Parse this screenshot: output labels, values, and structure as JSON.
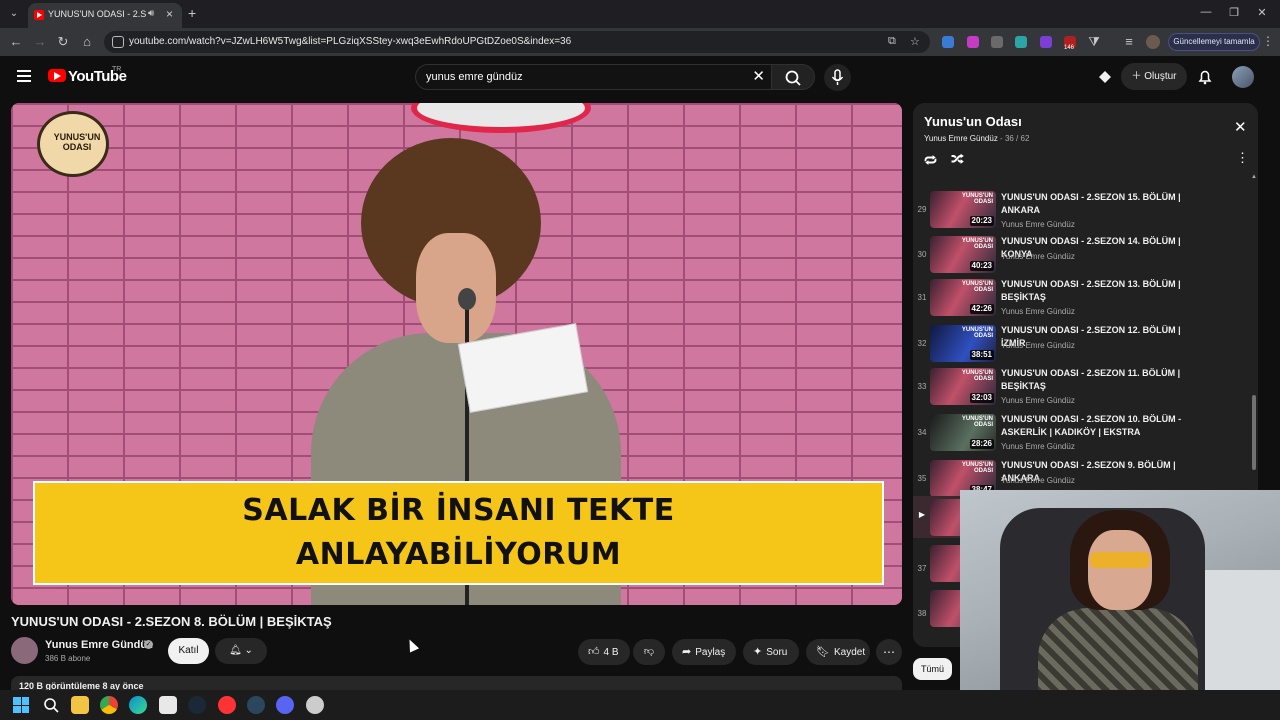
{
  "browser": {
    "tab_title": "YUNUS'UN ODASI - 2.SEZON 8. B",
    "url": "youtube.com/watch?v=JZwLH6W5Twg&list=PLGziqXSStey-xwq3eEwhRdoUPGtDZoe0S&index=36",
    "update_button": "Güncellemeyi tamamla",
    "extension_badge": "146"
  },
  "header": {
    "logo_text": "YouTube",
    "region": "TR",
    "search_value": "yunus emre gündüz",
    "create_label": "Oluştur"
  },
  "player": {
    "caption_line1": "SALAK BİR İNSANI TEKTE",
    "caption_line2": "ANLAYABİLİYORUM",
    "corner_logo": "YUNUS'UN ODASI"
  },
  "video": {
    "title": "YUNUS'UN ODASI - 2.SEZON 8. BÖLÜM | BEŞİKTAŞ",
    "channel": "Yunus Emre Gündüz",
    "subscribers": "386 B abone",
    "join_label": "Katıl",
    "likes": "4 B",
    "share_label": "Paylaş",
    "ask_label": "Soru",
    "save_label": "Kaydet",
    "description_peek": "120 B görüntüleme  8 ay önce"
  },
  "playlist": {
    "title": "Yunus'un Odası",
    "owner": "Yunus Emre Gündüz",
    "position": "36 / 62",
    "items": [
      {
        "index": "29",
        "title": "YUNUS'UN ODASI - 2.SEZON 15. BÖLÜM | ANKARA",
        "author": "Yunus Emre Gündüz",
        "duration": "20:23"
      },
      {
        "index": "30",
        "title": "YUNUS'UN ODASI - 2.SEZON 14. BÖLÜM | KONYA",
        "author": "Yunus Emre Gündüz",
        "duration": "40:23"
      },
      {
        "index": "31",
        "title": "YUNUS'UN ODASI - 2.SEZON 13. BÖLÜM | BEŞİKTAŞ",
        "author": "Yunus Emre Gündüz",
        "duration": "42:26"
      },
      {
        "index": "32",
        "title": "YUNUS'UN ODASI - 2.SEZON 12. BÖLÜM | İZMİR",
        "author": "Yunus Emre Gündüz",
        "duration": "38:51"
      },
      {
        "index": "33",
        "title": "YUNUS'UN ODASI - 2.SEZON 11. BÖLÜM | BEŞİKTAŞ",
        "author": "Yunus Emre Gündüz",
        "duration": "32:03"
      },
      {
        "index": "34",
        "title": "YUNUS'UN ODASI - 2.SEZON 10. BÖLÜM - ASKERLİK | KADIKÖY | EKSTRA",
        "author": "Yunus Emre Gündüz",
        "duration": "28:26"
      },
      {
        "index": "35",
        "title": "YUNUS'UN ODASI - 2.SEZON 9. BÖLÜM | ANKARA",
        "author": "Yunus Emre Gündüz",
        "duration": "38:47"
      }
    ],
    "partial_indices": [
      "▶",
      "37",
      "38"
    ],
    "all_chip": "Tümü"
  }
}
